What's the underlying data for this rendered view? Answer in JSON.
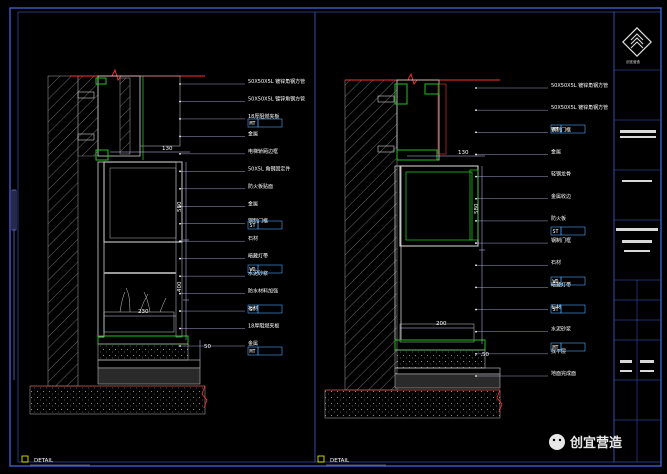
{
  "window": {
    "title": "DETAIL drawing sheet"
  },
  "colors": {
    "background": "#000000",
    "border": "#3a5fcd",
    "leader": "#c8c8ff",
    "tag_box": "#4aa8ff",
    "accent_red": "#ff3030",
    "green": "#20c020",
    "hatch": "#7a7a7a"
  },
  "left_detail": {
    "title": "DETAIL",
    "dims": {
      "d1": "130",
      "d2": "580",
      "d3": "400",
      "d4": "230",
      "d5": "50"
    },
    "labels": [
      "50X50X5L 镀锌角钢方管",
      "50X50X5L 镀锌角钢方管",
      "18厚阻燃夹板",
      "金属",
      "电梯轿厢边框",
      "50X5L 角钢固定件",
      "防火板贴面",
      "金属",
      "钢制门框",
      "石材",
      "暗藏灯带",
      "水泥砂浆",
      "防水材料加强",
      "石材",
      "18厚阻燃夹板",
      "金属"
    ],
    "tags": [
      "MT",
      "ST",
      "WD",
      "ST",
      "MT"
    ]
  },
  "right_detail": {
    "title": "DETAIL",
    "dims": {
      "d1": "130",
      "d2": "580",
      "d3": "200",
      "d4": "50"
    },
    "labels": [
      "50X50X5L 镀锌角钢方管",
      "50X50X5L 镀锌角钢方管",
      "钢制门框",
      "金属",
      "轻钢龙骨",
      "金属收边",
      "防火板",
      "钢制门框",
      "石材",
      "暗藏灯带",
      "石材",
      "水泥砂浆",
      "找平层",
      "地面完成面"
    ],
    "tags": [
      "MT",
      "ST",
      "WD",
      "ST",
      "MT"
    ]
  },
  "title_block": {
    "logo_text": "创宜营造"
  },
  "watermark": {
    "text": "创宜营造"
  }
}
